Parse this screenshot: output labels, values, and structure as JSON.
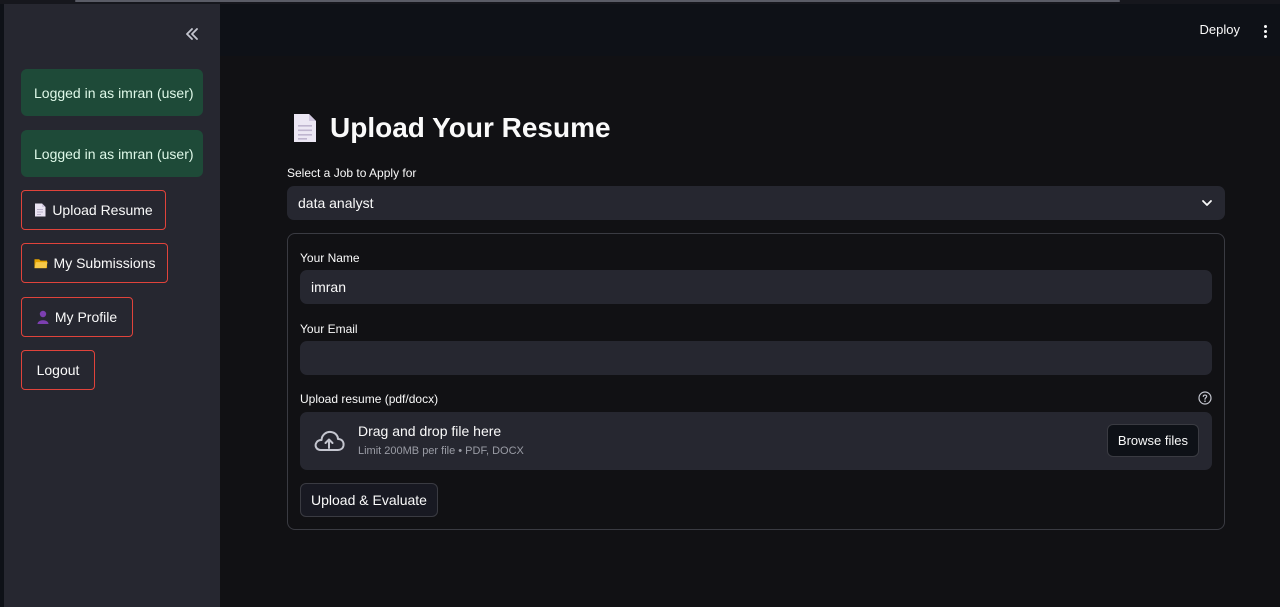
{
  "sidebar": {
    "alerts": [
      {
        "text": "Logged in as imran (user)"
      },
      {
        "text": "Logged in as imran (user)"
      }
    ],
    "nav": [
      {
        "label": "Upload Resume",
        "icon": "document-icon"
      },
      {
        "label": "My Submissions",
        "icon": "folder-icon"
      },
      {
        "label": "My Profile",
        "icon": "person-icon"
      },
      {
        "label": "Logout"
      }
    ],
    "collapse_icon": "double-chevron-left-icon"
  },
  "header": {
    "deploy_label": "Deploy",
    "menu_icon": "kebab-menu-icon"
  },
  "main": {
    "title": "Upload Your Resume",
    "title_icon": "document-icon",
    "job_select": {
      "label": "Select a Job to Apply for",
      "value": "data analyst"
    },
    "form": {
      "name_label": "Your Name",
      "name_value": "imran",
      "email_label": "Your Email",
      "email_value": "",
      "upload_label": "Upload resume (pdf/docx)",
      "dropzone_title": "Drag and drop file here",
      "dropzone_sub": "Limit 200MB per file • PDF, DOCX",
      "browse_label": "Browse files",
      "submit_label": "Upload & Evaluate"
    }
  },
  "colors": {
    "sidebar_bg": "#262730",
    "alert_bg": "#1e4a38",
    "button_border": "#e0433b",
    "app_bg": "#0e1117"
  }
}
